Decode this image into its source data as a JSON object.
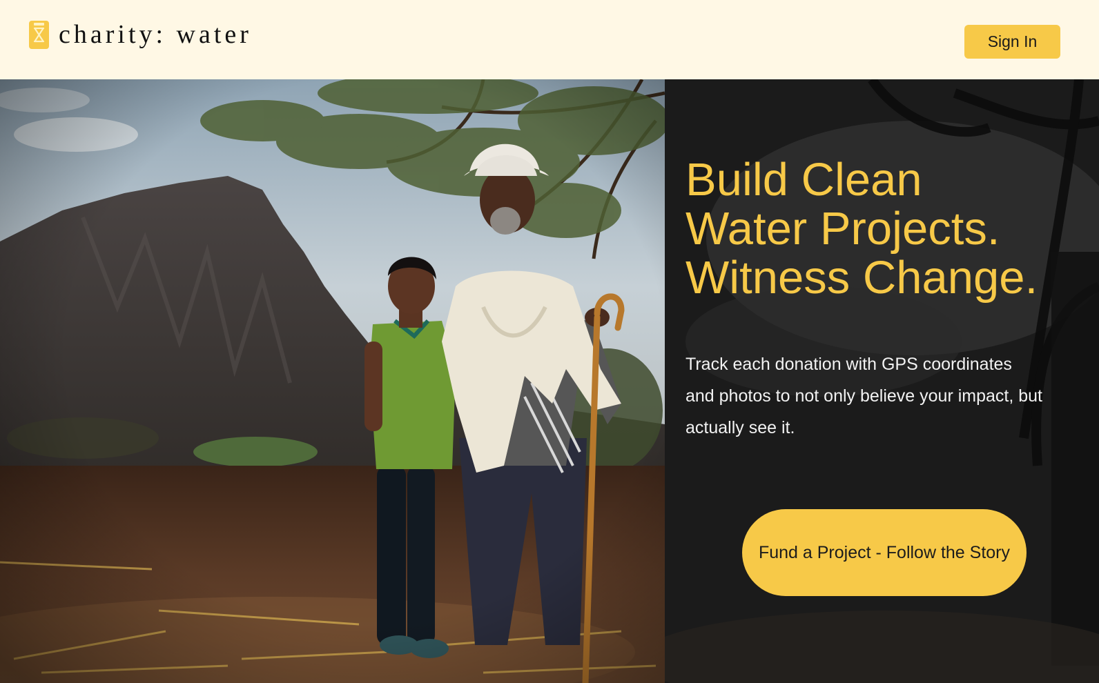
{
  "header": {
    "logo_text": "charity: water",
    "signin_label": "Sign In"
  },
  "hero": {
    "headline": [
      "Build Clean",
      "Water Projects.",
      "Witness Change."
    ],
    "description": "Track each donation with GPS coordinates and photos to not only believe your impact, but actually see it.",
    "cta_label": "Fund a Project - Follow the Story"
  },
  "colors": {
    "brand_yellow": "#f7c948",
    "header_background": "#fff8e5",
    "panel_background": "#1b1b1b"
  },
  "icons": {
    "logo": "jerry-can-icon"
  }
}
